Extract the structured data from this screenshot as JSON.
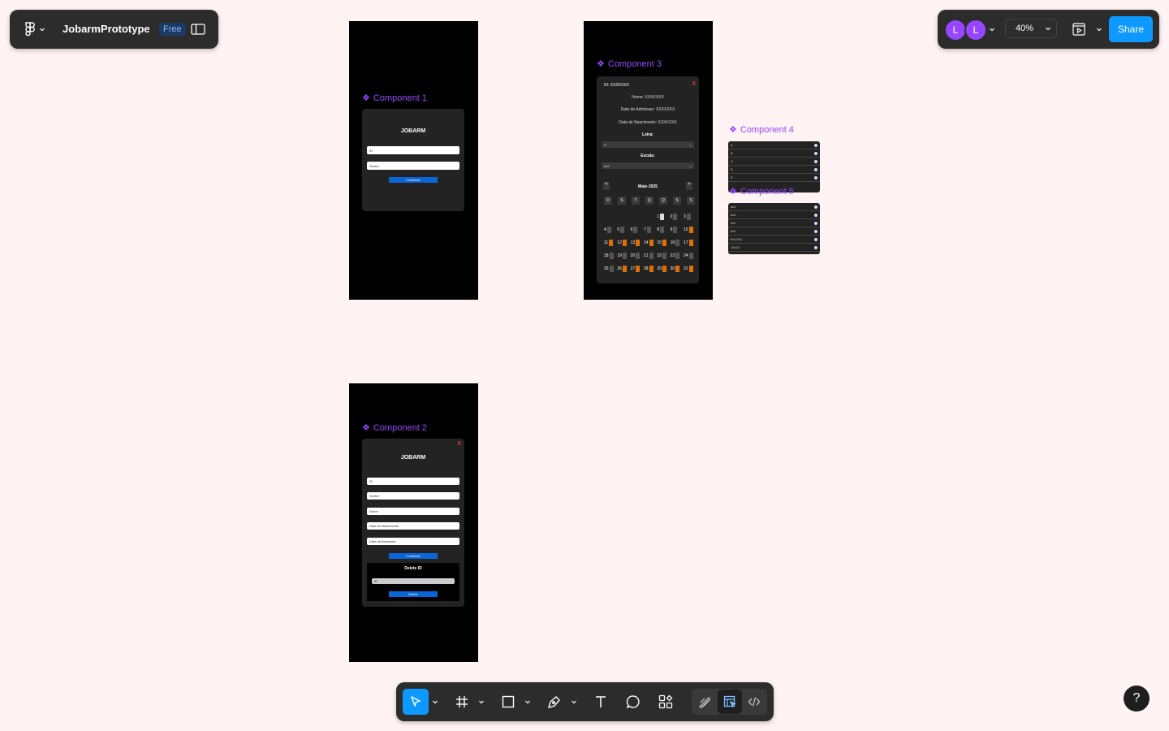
{
  "file": {
    "name": "JobarmPrototype",
    "plan_badge": "Free"
  },
  "topbar": {
    "avatars": [
      "L",
      "L"
    ],
    "zoom": "40%",
    "share_label": "Share"
  },
  "components": {
    "c1": {
      "label": "Component 1",
      "brand": "JOBARM",
      "id_placeholder": "ID",
      "password_placeholder": "Senha",
      "confirm_label": "Confirmar"
    },
    "c2": {
      "label": "Component 2",
      "close": "X",
      "brand": "JOBARM",
      "fields": [
        "ID",
        "Senha",
        "Nome",
        "Data de Nascimento",
        "Data de Admissao"
      ],
      "submit_label": "Confirmar",
      "delete_title": "Delete ID",
      "delete_field": "ID",
      "delete_button": "Delete"
    },
    "c3": {
      "label": "Component 3",
      "id_text": "ID: XXXXXXX",
      "close": "X",
      "name_text": "Nome: XXXXXXX",
      "admission_text": "Data de Admissao: XXXXXXX",
      "birth_text": "Data de Nascimento: XXXXXXX",
      "letra_label": "Letra:",
      "letra_value": "A",
      "escala_label": "Escala:",
      "escala_value": "6x2",
      "month": "Maio 2025",
      "prev": "<",
      "next": ">",
      "weekdays": [
        "D",
        "S",
        "T",
        "Q",
        "Q",
        "S",
        "S"
      ],
      "weeks": [
        [
          "",
          "",
          "",
          "",
          "1",
          "2",
          "3"
        ],
        [
          "4",
          "5",
          "6",
          "7",
          "8",
          "9",
          "10"
        ],
        [
          "11",
          "12",
          "13",
          "14",
          "15",
          "16",
          "17"
        ],
        [
          "18",
          "19",
          "20",
          "21",
          "22",
          "23",
          "24"
        ],
        [
          "25",
          "26",
          "27",
          "28",
          "29",
          "30",
          "31"
        ]
      ]
    },
    "c4": {
      "label": "Component 4",
      "options": [
        "A",
        "B",
        "C",
        "D",
        "E"
      ]
    },
    "c5": {
      "label": "Component 5",
      "options": [
        "6x2",
        "6x3",
        "5x2",
        "6x1",
        "6x1/3x2",
        "15x15"
      ]
    }
  },
  "colors": {
    "accent": "#0d99ff",
    "component": "#9747ff",
    "canvas": "#fff3f3",
    "orange": "#e06f00"
  }
}
